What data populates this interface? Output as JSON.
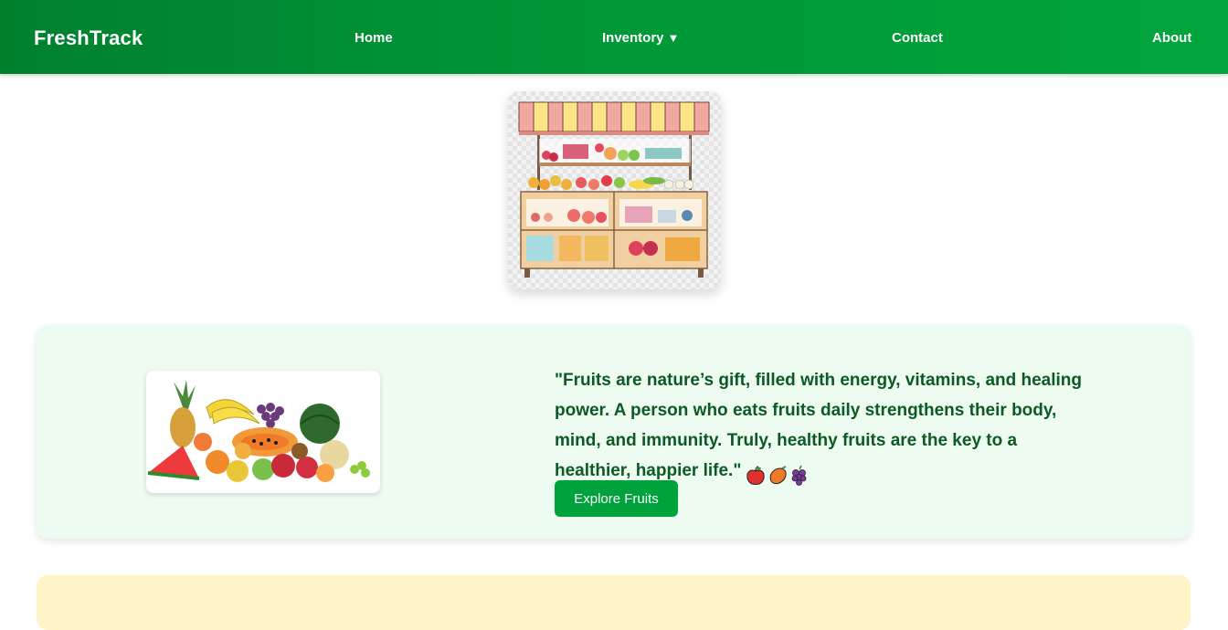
{
  "navbar": {
    "brand": "FreshTrack",
    "links": [
      {
        "label": "Home"
      },
      {
        "label": "Inventory"
      },
      {
        "label": "Contact"
      },
      {
        "label": "About"
      }
    ],
    "dropdown_caret": "▼"
  },
  "quote": {
    "text": "\"Fruits are nature’s gift, filled with energy, vitamins, and healing power. A person who eats fruits daily strengthens their body, mind, and immunity. Truly, healthy fruits are the key to a healthier, happier life.\"",
    "emojis": [
      "apple-emoji",
      "mango-emoji",
      "grapes-emoji"
    ],
    "button_label": "Explore Fruits"
  },
  "colors": {
    "nav_start": "#00802f",
    "nav_end": "#00a53c",
    "quote_bg": "#eefbf1",
    "quote_text": "#0c5a23",
    "button_bg": "#00a33b",
    "yellow_section_bg": "#fff3c8"
  }
}
